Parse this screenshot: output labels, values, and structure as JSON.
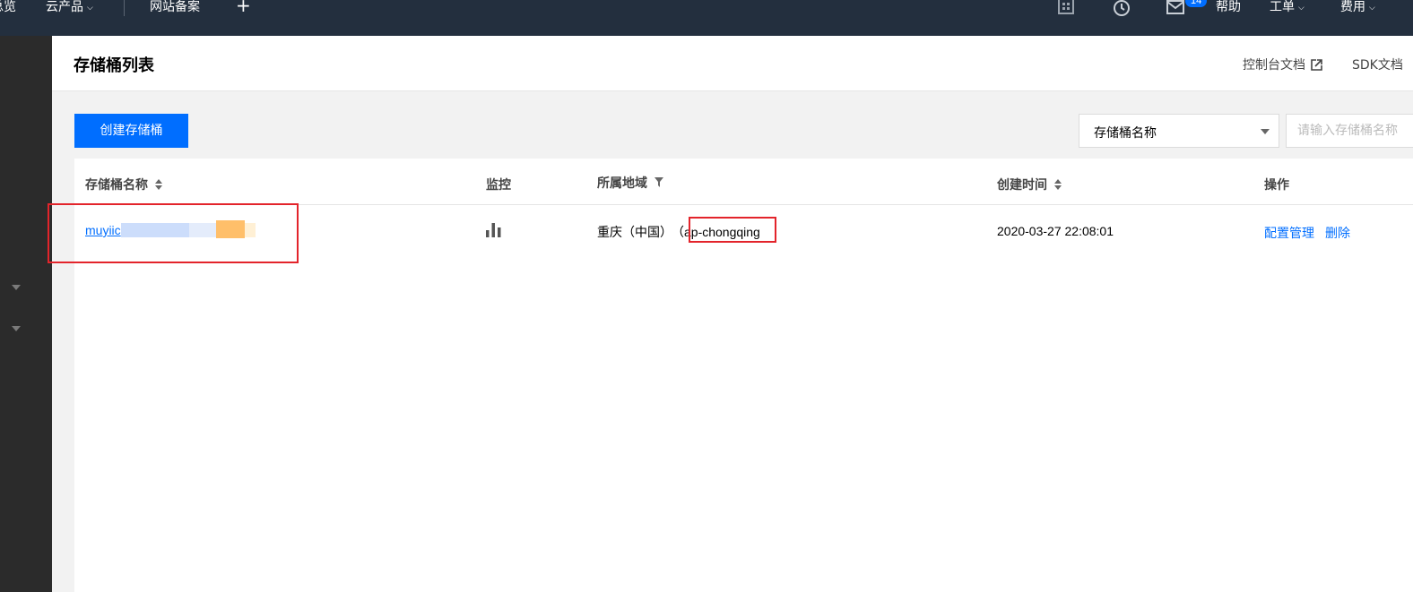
{
  "topbar": {
    "overview_partial": "总览",
    "products": "云产品",
    "filing": "网站备案",
    "badge_count": "14",
    "help": "帮助",
    "ticket": "工单",
    "billing": "费用"
  },
  "header": {
    "title": "存储桶列表",
    "console_docs": "控制台文档",
    "sdk_docs": "SDK文档"
  },
  "toolbar": {
    "create_button": "创建存储桶",
    "search_field_select": "存储桶名称",
    "search_placeholder": "请输入存储桶名称"
  },
  "table": {
    "columns": [
      "存储桶名称",
      "监控",
      "所属地域",
      "创建时间",
      "操作"
    ],
    "rows": [
      {
        "name": "muyiic",
        "region_label": "重庆（中国）",
        "region_code_prefix": "（",
        "region_code": "ap-chongqing",
        "created": "2020-03-27 22:08:01",
        "actions": [
          "配置管理",
          "删除"
        ]
      }
    ]
  },
  "colors": {
    "topbar": "#232f3e",
    "accent": "#006eff",
    "highlight": "#e3242b"
  }
}
